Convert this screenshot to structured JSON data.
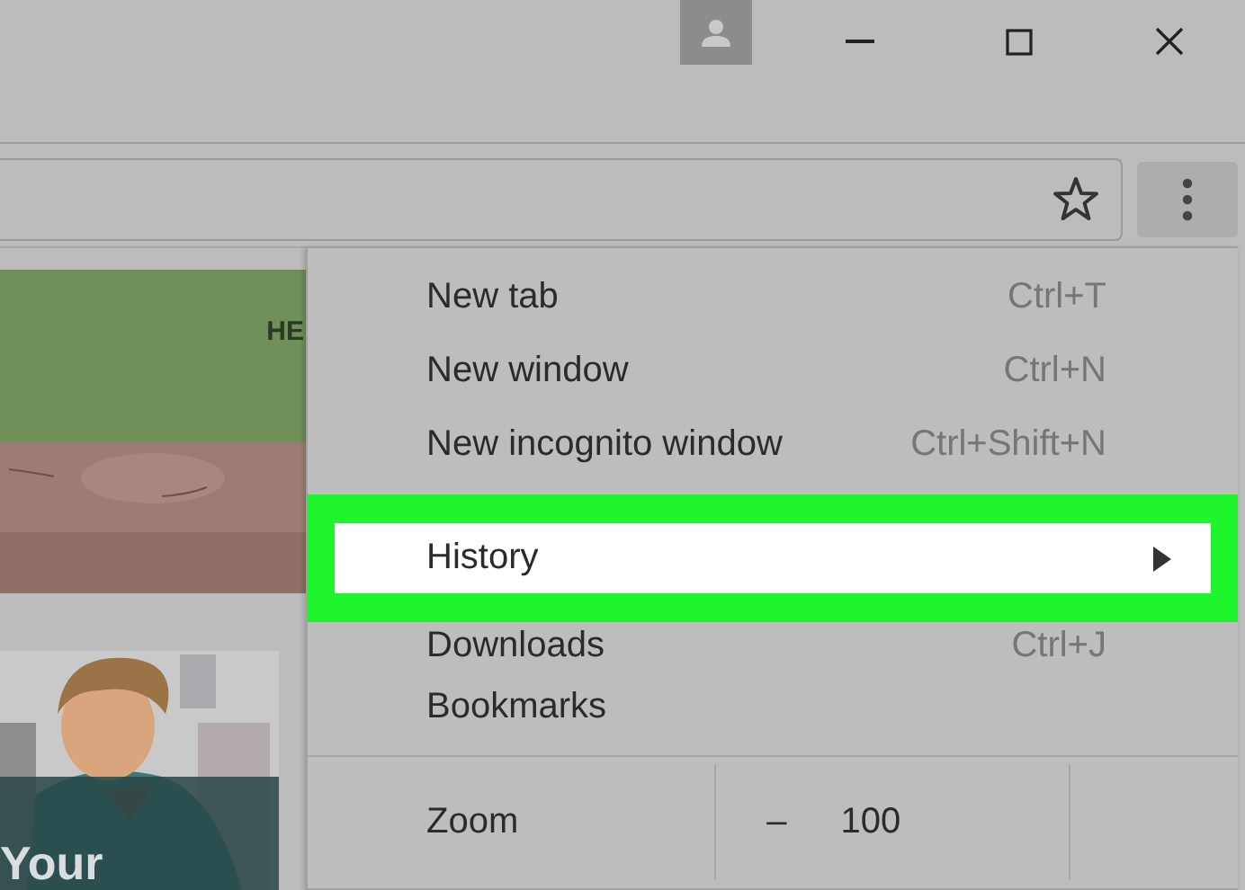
{
  "page": {
    "nav_label": "HE",
    "card_title": "Your"
  },
  "menu": {
    "items": [
      {
        "kind": "item",
        "label": "New tab",
        "shortcut": "Ctrl+T",
        "selected": false
      },
      {
        "kind": "item",
        "label": "New window",
        "shortcut": "Ctrl+N",
        "selected": false
      },
      {
        "kind": "item",
        "label": "New incognito window",
        "shortcut": "Ctrl+Shift+N",
        "selected": false
      },
      {
        "kind": "submenu",
        "label": "History",
        "selected": true
      },
      {
        "kind": "item",
        "label": "Downloads",
        "shortcut": "Ctrl+J",
        "selected": false
      },
      {
        "kind": "item",
        "label": "Bookmarks",
        "selected": false
      },
      {
        "kind": "zoom",
        "label": "Zoom",
        "minus": "–",
        "value": "100",
        "selected": false
      }
    ]
  }
}
